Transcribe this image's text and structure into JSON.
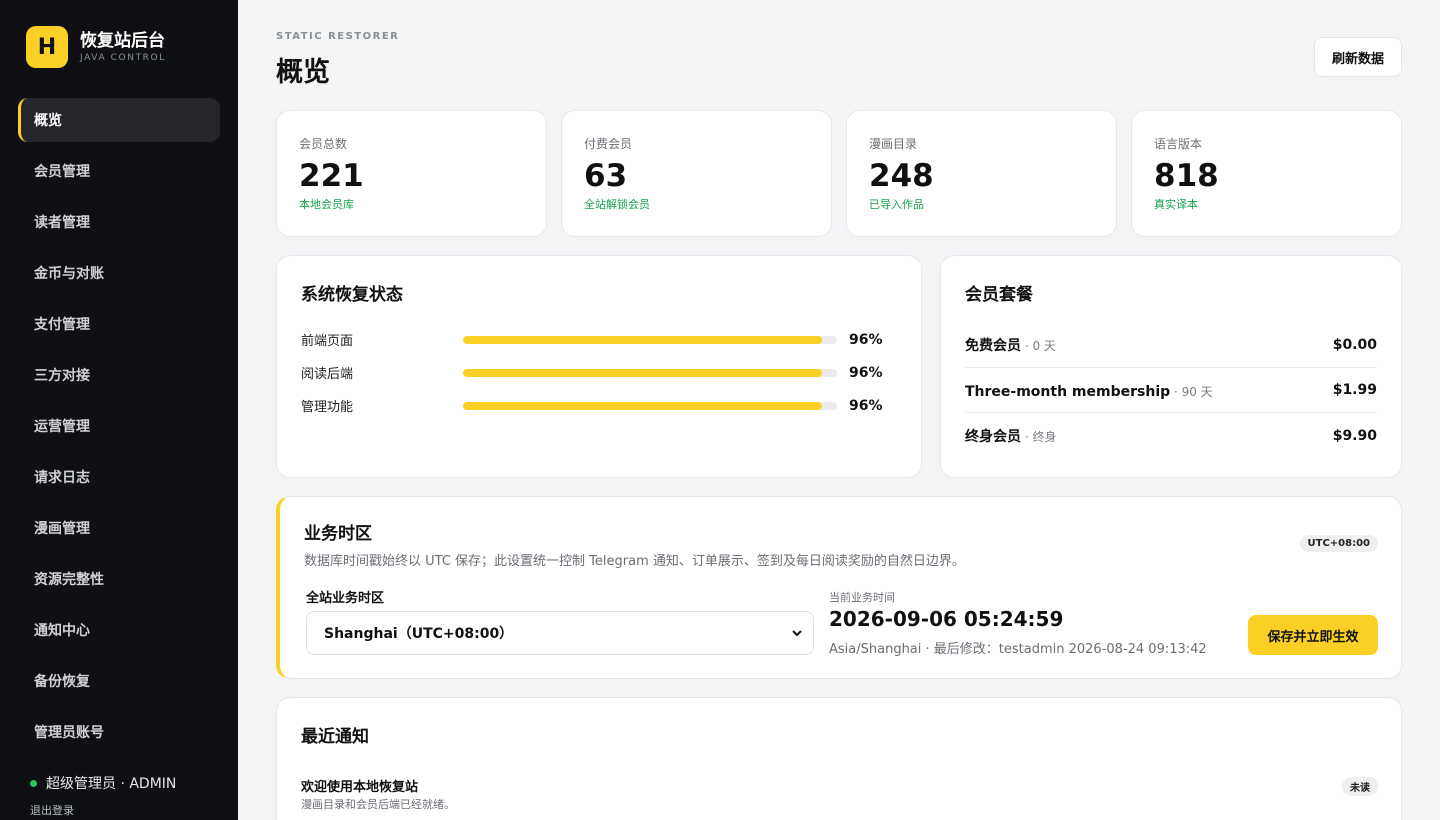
{
  "brand": {
    "logo_letter": "H",
    "title": "恢复站后台",
    "subtitle": "JAVA CONTROL"
  },
  "sidebar": {
    "items": [
      {
        "label": "概览",
        "active": true
      },
      {
        "label": "会员管理"
      },
      {
        "label": "读者管理"
      },
      {
        "label": "金币与对账"
      },
      {
        "label": "支付管理"
      },
      {
        "label": "三方对接"
      },
      {
        "label": "运营管理"
      },
      {
        "label": "请求日志"
      },
      {
        "label": "漫画管理"
      },
      {
        "label": "资源完整性"
      },
      {
        "label": "通知中心"
      },
      {
        "label": "备份恢复"
      },
      {
        "label": "管理员账号"
      }
    ],
    "user": "超级管理员 · ADMIN",
    "logout": "退出登录"
  },
  "header": {
    "eyebrow": "STATIC RESTORER",
    "title": "概览",
    "refresh_label": "刷新数据"
  },
  "stats": [
    {
      "label": "会员总数",
      "value": "221",
      "sub": "本地会员库"
    },
    {
      "label": "付费会员",
      "value": "63",
      "sub": "全站解锁会员"
    },
    {
      "label": "漫画目录",
      "value": "248",
      "sub": "已导入作品"
    },
    {
      "label": "语言版本",
      "value": "818",
      "sub": "真实译本"
    }
  ],
  "restore_status": {
    "title": "系统恢复状态",
    "rows": [
      {
        "label": "前端页面",
        "percent": 96,
        "percent_label": "96%"
      },
      {
        "label": "阅读后端",
        "percent": 96,
        "percent_label": "96%"
      },
      {
        "label": "管理功能",
        "percent": 96,
        "percent_label": "96%"
      }
    ]
  },
  "plans": {
    "title": "会员套餐",
    "items": [
      {
        "name": "免费会员",
        "meta": " · 0 天",
        "price": "$0.00"
      },
      {
        "name": "Three-month membership",
        "meta": " · 90 天",
        "price": "$1.99"
      },
      {
        "name": "终身会员",
        "meta": " · 终身",
        "price": "$9.90"
      }
    ]
  },
  "timezone": {
    "title": "业务时区",
    "description": "数据库时间戳始终以 UTC 保存；此设置统一控制 Telegram 通知、订单展示、签到及每日阅读奖励的自然日边界。",
    "badge": "UTC+08:00",
    "field_label": "全站业务时区",
    "selected": "Shanghai（UTC+08:00）",
    "now_label": "当前业务时间",
    "now_value": "2026-09-06 05:24:59",
    "meta": "Asia/Shanghai · 最后修改：testadmin 2026-08-24 09:13:42",
    "save_label": "保存并立即生效"
  },
  "notices": {
    "title": "最近通知",
    "items": [
      {
        "title": "欢迎使用本地恢复站",
        "body": "漫画目录和会员后端已经就绪。",
        "badge": "未读"
      }
    ]
  },
  "colors": {
    "accent": "#fbd024",
    "sidebar_bg": "#0f1013",
    "positive": "#16a34a",
    "online": "#22c55e"
  }
}
